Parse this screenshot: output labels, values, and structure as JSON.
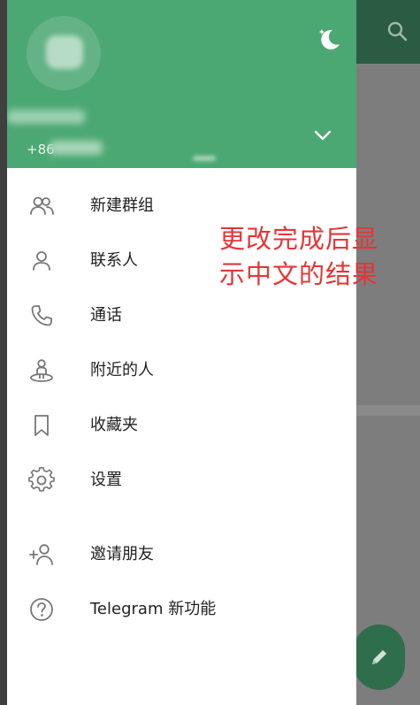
{
  "header": {
    "phone_prefix": "+86"
  },
  "menu": {
    "items": [
      {
        "label": "新建群组",
        "icon": "group-icon"
      },
      {
        "label": "联系人",
        "icon": "person-icon"
      },
      {
        "label": "通话",
        "icon": "phone-icon"
      },
      {
        "label": "附近的人",
        "icon": "nearby-people-icon"
      },
      {
        "label": "收藏夹",
        "icon": "bookmark-icon"
      },
      {
        "label": "设置",
        "icon": "gear-icon"
      },
      {
        "label": "邀请朋友",
        "icon": "add-person-icon"
      },
      {
        "label": "Telegram 新功能",
        "icon": "help-icon"
      }
    ]
  },
  "annotation": {
    "line1": "更改完成后显",
    "line2": "示中文的结果"
  },
  "colors": {
    "header_green": "#4ca873",
    "toolbar_dark_green": "#2b5b42",
    "annotation_red": "#e43636",
    "fab_green": "#2f6e4d"
  }
}
